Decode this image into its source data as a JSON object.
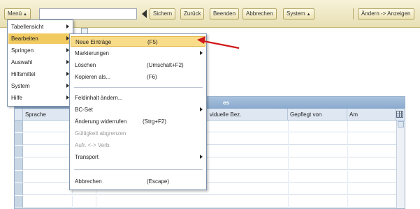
{
  "toolbar": {
    "menu_label": "Menü",
    "command_field_value": "",
    "buttons": [
      "Sichern",
      "Zurück",
      "Beenden",
      "Abbrechen",
      "System"
    ],
    "right_button": "Ändern -> Anzeigen"
  },
  "main_menu": {
    "items": [
      "Tabellensicht",
      "Bearbeiten",
      "Springen",
      "Auswahl",
      "Hilfsmittel",
      "System",
      "Hilfe"
    ],
    "active_index": 1
  },
  "edit_submenu": {
    "items": [
      {
        "label": "Neue Einträge",
        "shortcut": "(F5)"
      },
      {
        "label": "Markierungen",
        "shortcut": ""
      },
      {
        "label": "Löschen",
        "shortcut": "(Umschalt+F2)"
      },
      {
        "label": "Kopieren als...",
        "shortcut": "(F6)"
      },
      {
        "label": "Feldinhalt ändern...",
        "shortcut": ""
      },
      {
        "label": "BC-Set",
        "shortcut": ""
      },
      {
        "label": "Änderung widerrufen",
        "shortcut": "(Strg+F2)"
      },
      {
        "label": "Gültigkeit abgrenzen",
        "shortcut": ""
      },
      {
        "label": "Aufr. <-> Verb.",
        "shortcut": ""
      },
      {
        "label": "Transport",
        "shortcut": ""
      },
      {
        "label": "Abbrechen",
        "shortcut": "(Escape)"
      }
    ],
    "highlighted_index": 0
  },
  "table": {
    "title_fragment": "es",
    "columns": [
      "Sprache",
      "",
      "viduelle Bez.",
      "Gepflegt von",
      "Am"
    ]
  },
  "colors": {
    "toolbar_bg": "#ede4bd",
    "menu_active": "#f1ca60",
    "submenu_highlight": "#f9dc8a",
    "table_header": "#8aa9cc",
    "annotation_arrow": "#d0191c"
  },
  "icons": {
    "back": "triangle-left-icon",
    "submenu": "chevron-right-icon",
    "column_settings": "grid-icon",
    "annotation": "red-arrow-icon"
  }
}
